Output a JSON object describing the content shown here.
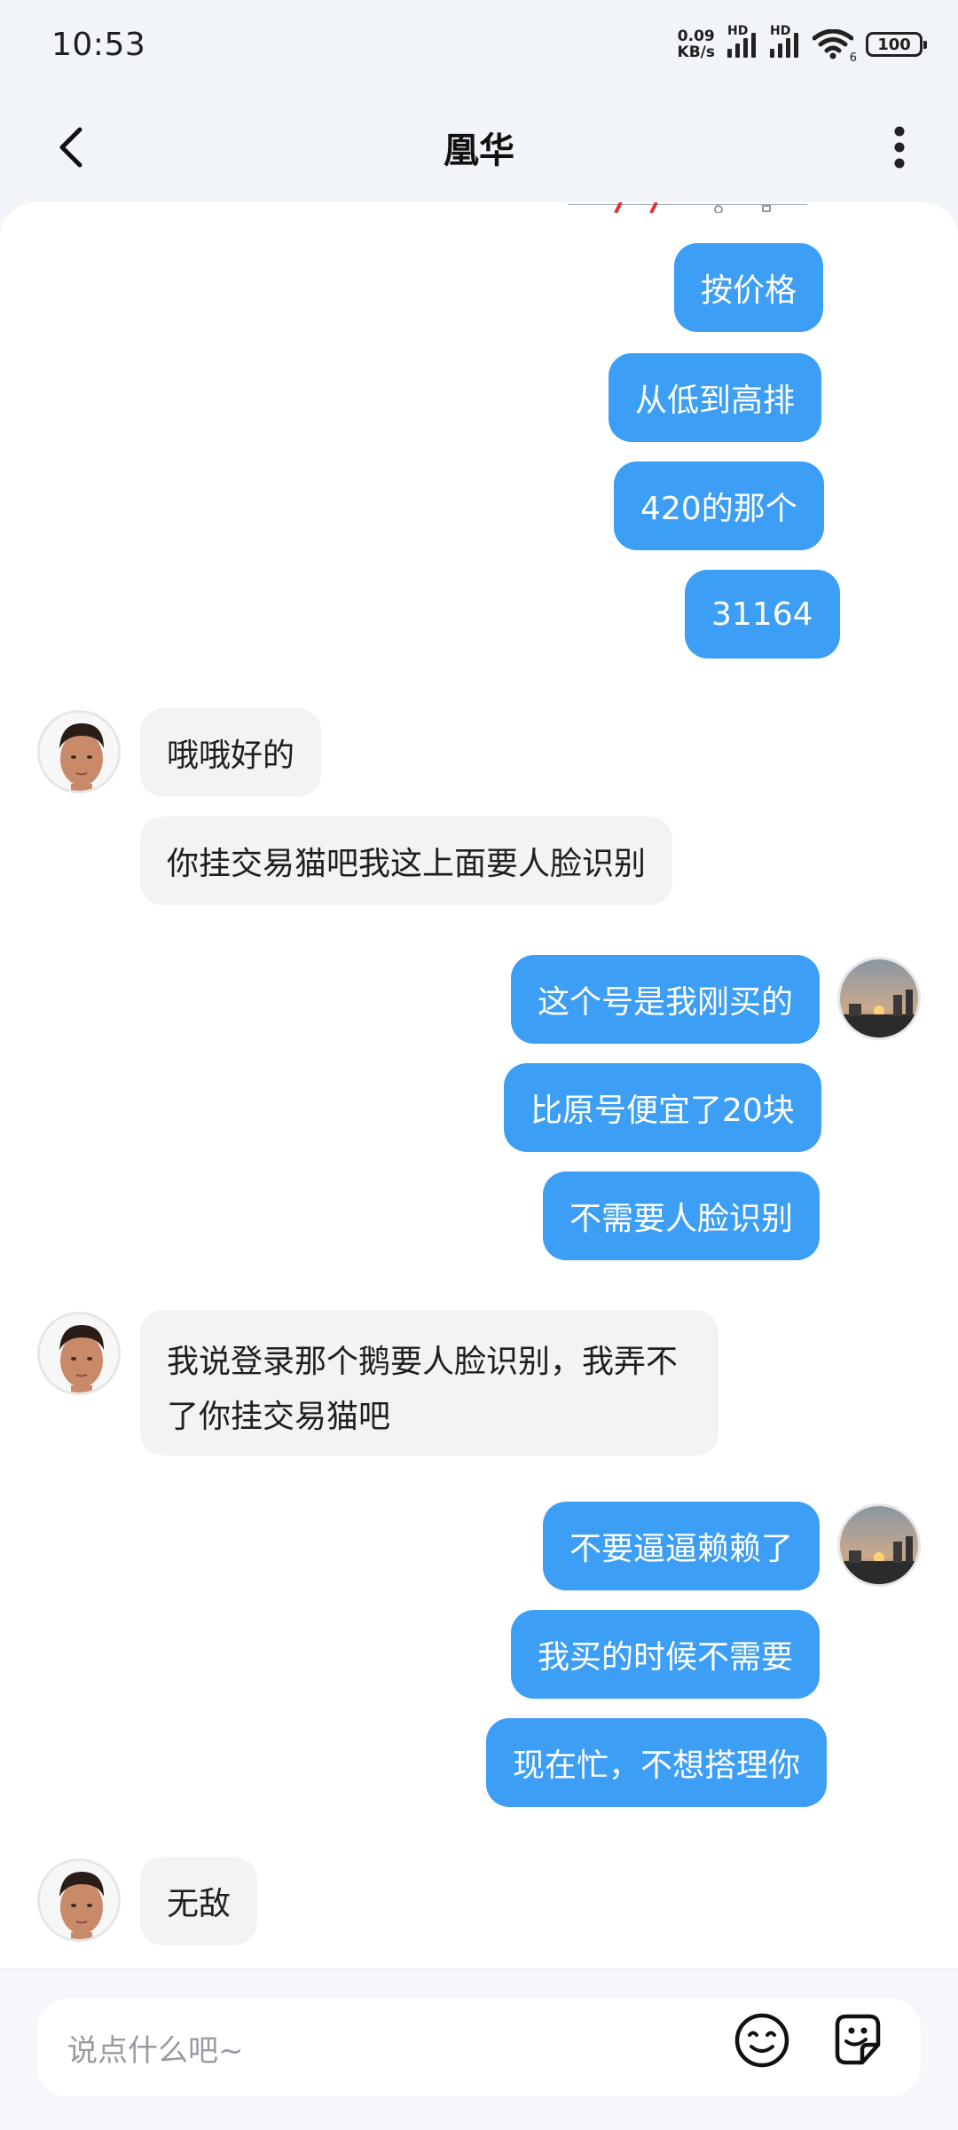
{
  "status_bar": {
    "time": "10:53",
    "net_speed_value": "0.09",
    "net_speed_unit": "KB/s",
    "hd1": "HD",
    "hd2": "HD",
    "wifi_number": "6",
    "battery": "100"
  },
  "header": {
    "title": "凰华",
    "back_icon": "chevron-left-icon",
    "more_icon": "vertical-dots-icon"
  },
  "messages": [
    {
      "side": "out",
      "text": "按价格"
    },
    {
      "side": "out",
      "text": "从低到高排"
    },
    {
      "side": "out",
      "text": "420的那个"
    },
    {
      "side": "out",
      "text": "31164"
    },
    {
      "side": "in",
      "text": "哦哦好的"
    },
    {
      "side": "in",
      "text": "你挂交易猫吧我这上面要人脸识别"
    },
    {
      "side": "out",
      "text": "这个号是我刚买的"
    },
    {
      "side": "out",
      "text": "比原号便宜了20块"
    },
    {
      "side": "out",
      "text": "不需要人脸识别"
    },
    {
      "side": "in",
      "text": "我说登录那个鹅要人脸识别，我弄不了你挂交易猫吧"
    },
    {
      "side": "out",
      "text": "不要逼逼赖赖了"
    },
    {
      "side": "out",
      "text": "我买的时候不需要"
    },
    {
      "side": "out",
      "text": "现在忙，不想搭理你"
    },
    {
      "side": "in",
      "text": "无敌"
    }
  ],
  "input": {
    "placeholder": "说点什么吧~",
    "emoji_icon": "smiley-icon",
    "sticker_icon": "sticker-icon"
  },
  "colors": {
    "outgoing_bubble": "#3c9ef5",
    "incoming_bubble": "#f3f3f5",
    "page_bg": "#f1f4f9"
  }
}
